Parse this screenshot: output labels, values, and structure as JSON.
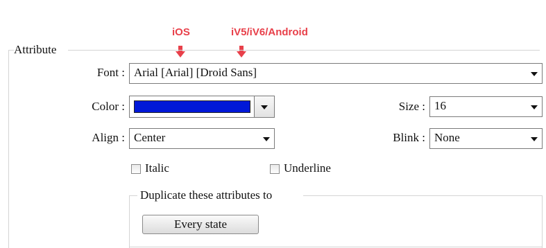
{
  "annotations": {
    "ios_label": "iOS",
    "android_label": "iV5/iV6/Android",
    "arrow_icon": "down-arrow-icon",
    "color": "#e8404a"
  },
  "attribute": {
    "group_title": "Attribute",
    "font_label": "Font :",
    "font_value": "Arial [Arial] [Droid Sans]",
    "color_label": "Color :",
    "color_value": "#0018d8",
    "size_label": "Size :",
    "size_value": "16",
    "align_label": "Align :",
    "align_value": "Center",
    "blink_label": "Blink :",
    "blink_value": "None",
    "italic_label": "Italic",
    "italic_checked": false,
    "underline_label": "Underline",
    "underline_checked": false
  },
  "duplicate": {
    "group_title": "Duplicate these attributes to",
    "every_state_label": "Every state"
  }
}
